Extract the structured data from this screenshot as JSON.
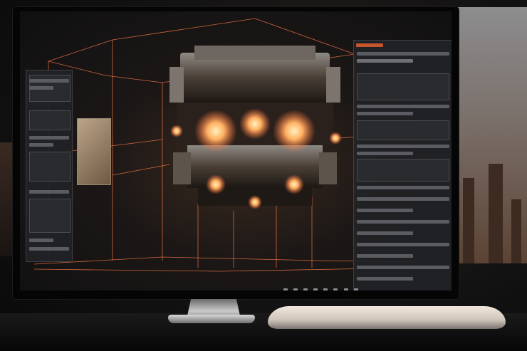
{
  "right_panel": {
    "badge": "",
    "header": "",
    "rows": []
  },
  "bottom_bar": {
    "icons": [
      "save-icon",
      "layers-icon",
      "move-icon",
      "rotate-icon",
      "scale-icon",
      "grid-icon",
      "camera-icon",
      "render-icon"
    ]
  },
  "colors": {
    "accent": "#ff6a3a",
    "glow": "#ffb062",
    "panel": "#222326"
  }
}
